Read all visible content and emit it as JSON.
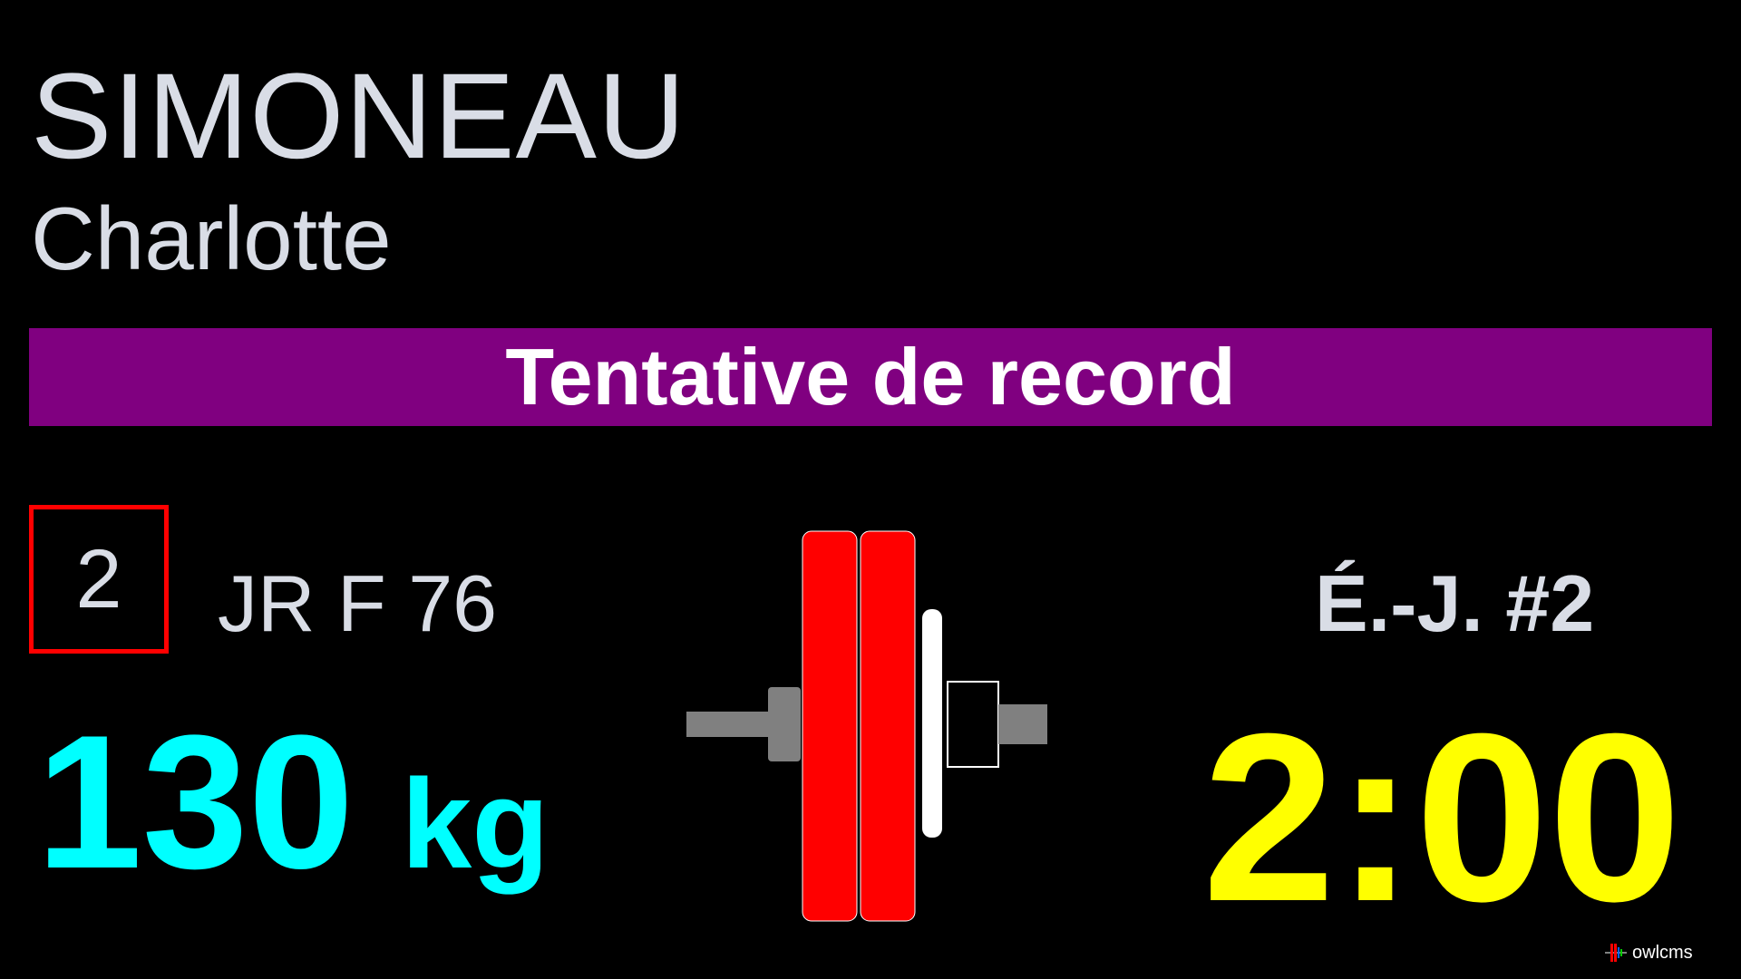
{
  "athlete": {
    "last_name": "SIMONEAU",
    "first_name": "Charlotte"
  },
  "banner": {
    "text": "Tentative de record",
    "background": "#800080"
  },
  "start_number": {
    "value": "2",
    "border_color": "#ff0000"
  },
  "category": "JR F 76",
  "requested_weight": {
    "value": "130",
    "unit": "kg",
    "color": "#00ffff"
  },
  "attempt": "É.-J. #2",
  "timer": {
    "value": "2:00",
    "color": "#ffff00"
  },
  "barbell": {
    "plates": [
      {
        "kind": "big-plate",
        "color": "#ff0000"
      },
      {
        "kind": "big-plate",
        "color": "#ff0000"
      },
      {
        "kind": "small-plate",
        "color": "#ffffff"
      },
      {
        "kind": "collar",
        "color": "#000000"
      }
    ],
    "bar_color": "#808080"
  },
  "brand": {
    "name": "owlcms",
    "icon": "owlcms-logo-icon"
  },
  "colors": {
    "background": "#000000",
    "text": "#d9dde6"
  }
}
